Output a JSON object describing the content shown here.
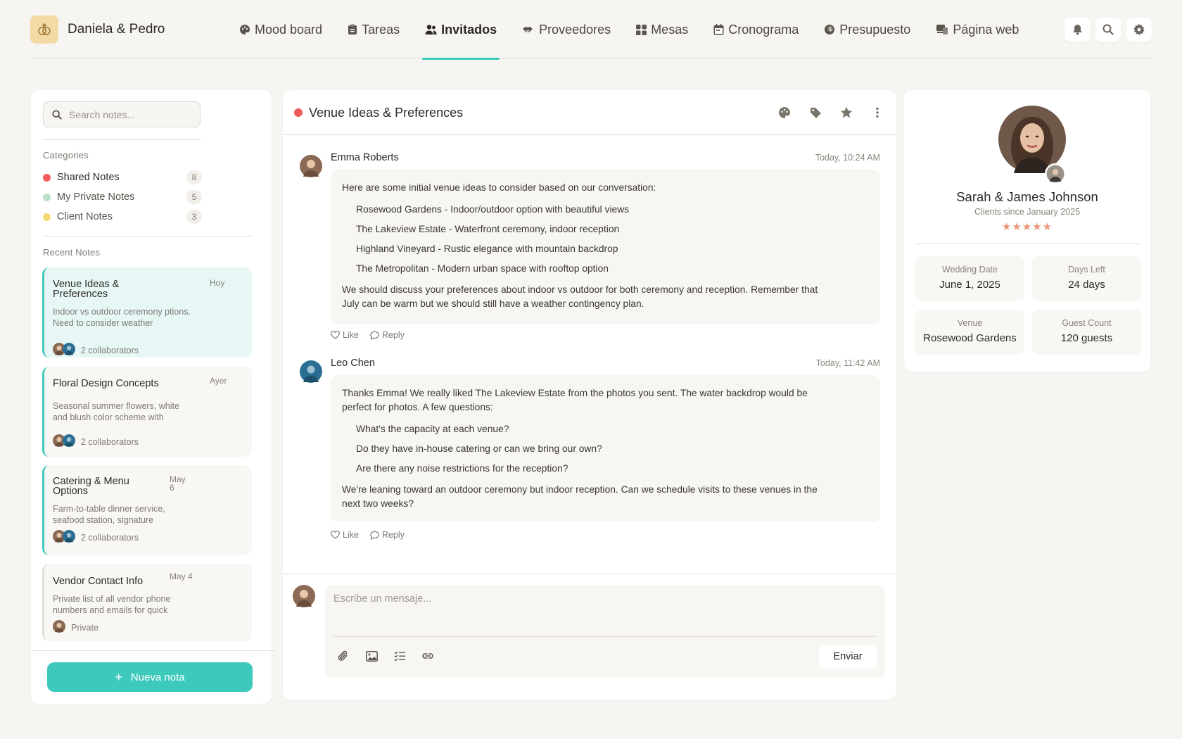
{
  "brand": {
    "name": "Daniela & Pedro"
  },
  "nav": [
    {
      "label": "Mood board",
      "icon": "palette-icon"
    },
    {
      "label": "Tareas",
      "icon": "clipboard-icon"
    },
    {
      "label": "Invitados",
      "icon": "users-icon",
      "active": true
    },
    {
      "label": "Proveedores",
      "icon": "handshake-icon"
    },
    {
      "label": "Mesas",
      "icon": "grid-icon"
    },
    {
      "label": "Cronograma",
      "icon": "calendar-icon"
    },
    {
      "label": "Presupuesto",
      "icon": "coins-icon"
    },
    {
      "label": "Página web",
      "icon": "laptop-icon"
    }
  ],
  "top_actions": [
    "bell-icon",
    "search-icon",
    "gear-icon"
  ],
  "sidebar": {
    "search_placeholder": "Search notes...",
    "categories_title": "Categories",
    "categories": [
      {
        "label": "Shared Notes",
        "count": "8",
        "color": "#f05b5b"
      },
      {
        "label": "My Private Notes",
        "count": "5",
        "color": "#b9e0c9"
      },
      {
        "label": "Client Notes",
        "count": "3",
        "color": "#f7d878"
      }
    ],
    "recent_title": "Recent Notes",
    "notes": [
      {
        "title": "Venue Ideas & Preferences",
        "date": "Hoy",
        "excerpt": "Indoor vs outdoor ceremony ptions. Need to consider weather",
        "collab": "2 collaborators"
      },
      {
        "title": "Floral Design Concepts",
        "date": "Ayer",
        "excerpt": "Seasonal summer flowers, white and blush color scheme with",
        "collab": "2 collaborators"
      },
      {
        "title": "Catering & Menu Options",
        "date": "May 6",
        "excerpt": "Farm-to-table dinner service, seafood station, signature",
        "collab": "2 collaborators"
      },
      {
        "title": "Vendor Contact Info",
        "date": "May 4",
        "excerpt": "Private list of all vendor phone numbers and emails for quick",
        "collab": "Private"
      }
    ],
    "new_note_label": "Nueva nota"
  },
  "conversation": {
    "title": "Venue Ideas & Preferences",
    "dot_color": "#f05b5b",
    "messages": [
      {
        "author": "Emma Roberts",
        "time": "Today, 10:24 AM",
        "intro": "Here are some initial venue ideas to consider based on our conversation:",
        "items": [
          "Rosewood Gardens - Indoor/outdoor option with beautiful views",
          "The Lakeview Estate - Waterfront ceremony, indoor reception",
          "Highland Vineyard - Rustic elegance with mountain backdrop",
          "The Metropolitan - Modern urban space with rooftop option"
        ],
        "outro": "We should discuss your preferences about indoor vs outdoor for both ceremony and reception. Remember that July can be warm but we should still have a weather contingency plan.",
        "like": "Like",
        "reply": "Reply"
      },
      {
        "author": "Leo Chen",
        "time": "Today, 11:42 AM",
        "intro": "Thanks Emma! We really liked The Lakeview Estate from the photos you sent. The water backdrop would be perfect for photos. A few questions:",
        "items": [
          "What's the capacity at each venue?",
          "Do they have in-house catering or can we bring our own?",
          "Are there any noise restrictions for the reception?"
        ],
        "outro": "We're leaning toward an outdoor ceremony but indoor reception. Can we schedule visits to these venues in the next two weeks?",
        "like": "Like",
        "reply": "Reply"
      }
    ],
    "composer_placeholder": "Escribe un mensaje...",
    "send_label": "Enviar"
  },
  "client": {
    "name": "Sarah & James Johnson",
    "since": "Clients since January 2025",
    "stars": "★★★★★",
    "rating": 5,
    "stats": [
      {
        "label": "Wedding Date",
        "value": "June 1, 2025"
      },
      {
        "label": "Days Left",
        "value": "24 days"
      },
      {
        "label": "Venue",
        "value": "Rosewood Gardens"
      },
      {
        "label": "Guest Count",
        "value": "120 guests"
      }
    ]
  }
}
